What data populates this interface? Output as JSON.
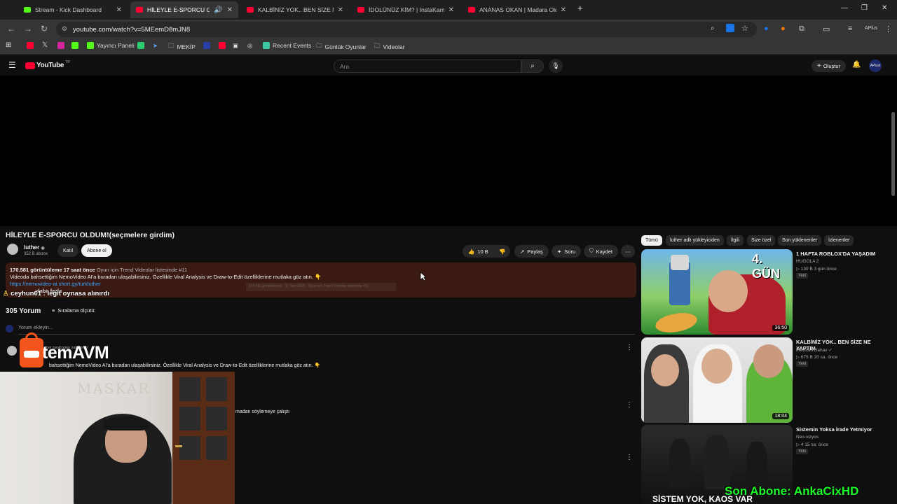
{
  "browser": {
    "tabs": [
      {
        "title": "Stream - Kick Dashboard",
        "color": "#53fc18"
      },
      {
        "title": "HİLEYLE E-SPORCU OLDUM",
        "color": "#ff0033"
      },
      {
        "title": "KALBİNİZ YOK.. BEN SİZE NE YA",
        "color": "#ff0033"
      },
      {
        "title": "İDOLÜNÜZ KİM? | InstaKarma",
        "color": "#ff0033"
      },
      {
        "title": "ANANAS OKAN | Madara Oldu",
        "color": "#ff0033"
      }
    ],
    "url": "youtube.com/watch?v=5MEemD8mJN8",
    "bookmarks": [
      "Yayıncı Paneli",
      "MEKİP",
      "Recent Events",
      "Günlük Oyunlar",
      "Videolar"
    ]
  },
  "youtube": {
    "logo": "YouTube",
    "logo_sup": "TR",
    "search_placeholder": "Ara",
    "create_label": "Oluştur",
    "avatar_text": "APlust"
  },
  "video": {
    "title": "HİLEYLE E-SPORCU OLDUM!(seçmelere girdim)",
    "channel": "luther",
    "subs": "352 B abone",
    "join": "Katıl",
    "subscribe": "Abone ol",
    "likes": "10 B",
    "share": "Paylaş",
    "ask": "Soru",
    "save": "Kaydet",
    "desc_stats": "170.581 görüntüleme  17 saat önce",
    "desc_trend": "Oyun için Trend Videolar listesinde #11",
    "desc_line": "Videoda bahsettiğim NemoVideo AI'a buradan ulaşabilirsiniz. Özellikle Viral Analysis ve Draw-to-Edit özelliklerine mutlaka göz atın. 👇",
    "desc_link": "https://nemovideo-ai.short.gy/turkluther",
    "desc_more": "daha fazla",
    "desc_ghost": "170.581 görüntüleme · 17 Tem 2025 · Oyun için Trend Videolar listesinde #11"
  },
  "overlay": {
    "chat": "ceyhun61 : legit oynasa alınırdı",
    "brand": "temAVM",
    "follower_text": "Son Abone: AnkaCixHD"
  },
  "comments": {
    "count": "305 Yorum",
    "sort": "Sıralama ölçütü:",
    "add": "Yorum ekleyin...",
    "pinned": "luther tarafından sabitlendi",
    "first": "bahsettiğim NemoVideo AI'a buradan ulaşabilirsiniz. Özellikle Viral Analysis ve Draw-to-Edit özelliklerine mutlaka göz atın. 👇",
    "second": "madan söylemeye çalıştı"
  },
  "side": {
    "chips": [
      "Tümü",
      "luther adlı yükleyiciden",
      "İlgili",
      "Size özel",
      "Son yüklenenler",
      "İzlenenler"
    ],
    "videos": [
      {
        "title": "1 HAFTA ROBLOX'DA YAŞADIM",
        "channel": "HUGOLA 2",
        "meta": "▷ 130 B  3 gün önce",
        "badge": "Yeni",
        "duration": "36:50",
        "overlay": "4. GÜN"
      },
      {
        "title": "KALBİNİZ YOK.. BEN SİZE NE YAPTIM",
        "channel": "Mevlcan Bahav ✓",
        "meta": "▷ 675 B  20 sa. önce",
        "badge": "Yeni",
        "duration": "18:04",
        "overlay": ""
      },
      {
        "title": "Sistemin Yoksa İrade Yetmiyor",
        "channel": "Neo-vizyos",
        "meta": "▷ 4  15 sa. önce",
        "badge": "Yeni",
        "duration": "",
        "overlay": "SİSTEM YOK, KAOS VAR"
      }
    ]
  }
}
